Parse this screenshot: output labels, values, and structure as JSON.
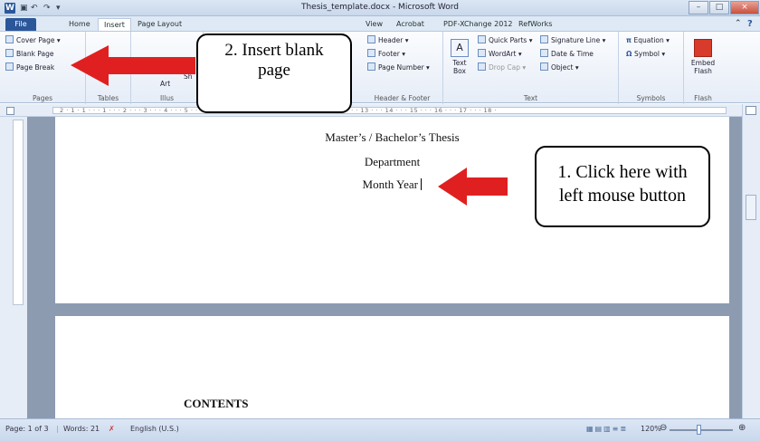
{
  "window": {
    "title": "Thesis_template.docx - Microsoft Word",
    "app_icon": "W",
    "minimize": "–",
    "maximize": "□",
    "close": "×"
  },
  "tabs": [
    "File",
    "Home",
    "Insert",
    "Page Layout",
    "View",
    "Acrobat",
    "PDF-XChange 2012",
    "RefWorks"
  ],
  "ribbon": {
    "pages": {
      "cover_page": "Cover Page",
      "blank_page": "Blank Page",
      "page_break": "Page Break",
      "label": "Pages"
    },
    "tables": {
      "label": "Tables"
    },
    "illustrations": {
      "shapes": "Sh",
      "art": "Art",
      "label": "Illus"
    },
    "header_footer": {
      "header": "Header",
      "footer": "Footer",
      "page_number": "Page Number",
      "label": "Header & Footer"
    },
    "text": {
      "text_box": "Text Box",
      "quick_parts": "Quick Parts",
      "wordart": "WordArt",
      "drop_cap": "Drop Cap",
      "signature_line": "Signature Line",
      "date_time": "Date & Time",
      "object": "Object",
      "label": "Text"
    },
    "symbols": {
      "equation": "Equation",
      "symbol": "Symbol",
      "label": "Symbols"
    },
    "flash": {
      "embed_flash": "Embed Flash",
      "label": "Flash"
    }
  },
  "ruler_marks": "2 · 1 · 1 · · · 1 · · · 2 · · · 3 · · · 4 · · · 5 · · · 6 · · · 7 · · · 8 · · · 9 · · · 10 · · · 11 · · · 12 · · · 13 · · · 14 · · · 15 · · · 16 · · · 17 · · · 18 ·",
  "document": {
    "line1": "Master’s / Bachelor’s Thesis",
    "line2": "Department",
    "line3": "Month Year",
    "contents": "CONTENTS"
  },
  "callouts": {
    "insert": "2. Insert blank page",
    "click": "1. Click here with left mouse button"
  },
  "status": {
    "page": "Page: 1 of 3",
    "words": "Words: 21",
    "language": "English (U.S.)",
    "zoom": "120%"
  },
  "colors": {
    "accent": "#2b579a",
    "arrow": "#e02020"
  }
}
